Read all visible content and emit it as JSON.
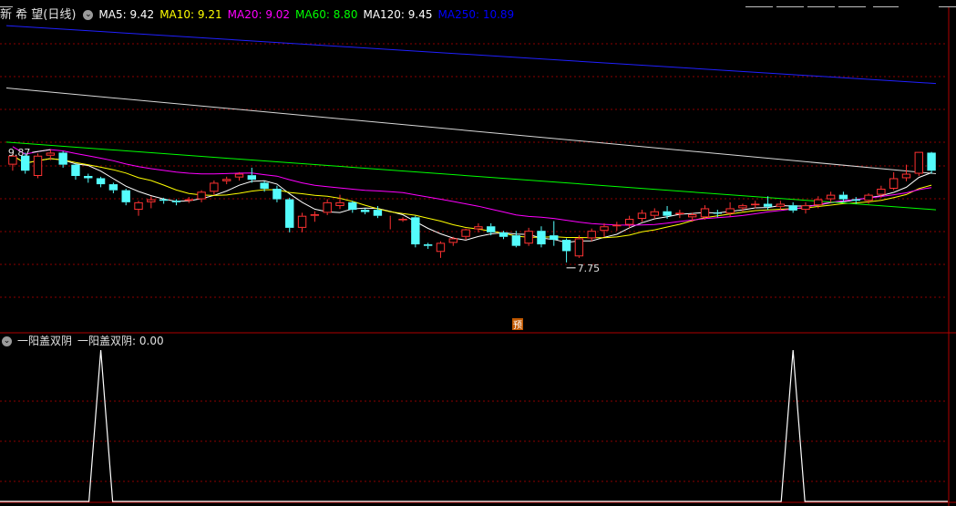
{
  "stock": {
    "name": "新 希 望",
    "period": "(日线)"
  },
  "ma_header": [
    {
      "label": "MA5: 9.42",
      "color": "#ffffff"
    },
    {
      "label": "MA10: 9.21",
      "color": "#ffff00"
    },
    {
      "label": "MA20: 9.02",
      "color": "#ff00ff"
    },
    {
      "label": "MA60: 8.80",
      "color": "#00ff00"
    },
    {
      "label": "MA120: 9.45",
      "color": "#ffffff"
    },
    {
      "label": "MA250: 10.89",
      "color": "#0000ff"
    }
  ],
  "indicator": {
    "name": "一阳盖双阴",
    "value_label": "一阳盖双阴: 0.00"
  },
  "annotations": {
    "high": "9.87",
    "low": "7.75",
    "marker": "预"
  },
  "colors": {
    "up": "#ff3232",
    "down": "#54fcfc",
    "grid": "#8b0000",
    "bg": "#000000"
  },
  "chart_data": {
    "type": "candlestick",
    "ylim": [
      7.5,
      11.6
    ],
    "candles": [
      [
        9.7,
        9.82,
        9.62,
        9.85
      ],
      [
        9.82,
        9.62,
        9.58,
        9.86
      ],
      [
        9.55,
        9.82,
        9.52,
        9.85
      ],
      [
        9.82,
        9.86,
        9.76,
        9.9
      ],
      [
        9.86,
        9.7,
        9.66,
        9.88
      ],
      [
        9.7,
        9.55,
        9.5,
        9.72
      ],
      [
        9.55,
        9.52,
        9.46,
        9.58
      ],
      [
        9.52,
        9.44,
        9.4,
        9.54
      ],
      [
        9.44,
        9.36,
        9.32,
        9.46
      ],
      [
        9.36,
        9.2,
        9.16,
        9.38
      ],
      [
        9.1,
        9.2,
        9.02,
        9.22
      ],
      [
        9.2,
        9.24,
        9.12,
        9.28
      ],
      [
        9.24,
        9.22,
        9.18,
        9.26
      ],
      [
        9.22,
        9.2,
        9.16,
        9.24
      ],
      [
        9.22,
        9.24,
        9.19,
        9.27
      ],
      [
        9.24,
        9.34,
        9.2,
        9.36
      ],
      [
        9.34,
        9.46,
        9.3,
        9.49
      ],
      [
        9.48,
        9.51,
        9.44,
        9.54
      ],
      [
        9.53,
        9.58,
        9.49,
        9.6
      ],
      [
        9.56,
        9.5,
        9.46,
        9.66
      ],
      [
        9.46,
        9.38,
        9.34,
        9.48
      ],
      [
        9.38,
        9.24,
        9.2,
        9.42
      ],
      [
        9.24,
        8.86,
        8.8,
        9.26
      ],
      [
        8.86,
        9.02,
        8.8,
        9.06
      ],
      [
        9.02,
        9.04,
        8.94,
        9.08
      ],
      [
        9.06,
        9.2,
        9.03,
        9.24
      ],
      [
        9.15,
        9.2,
        9.11,
        9.3
      ],
      [
        9.2,
        9.1,
        9.06,
        9.22
      ],
      [
        9.1,
        9.07,
        9.04,
        9.12
      ],
      [
        9.1,
        9.02,
        8.99,
        9.15
      ],
      [
        9.0,
        9.0,
        8.84,
        9.02
      ],
      [
        8.96,
        8.98,
        8.94,
        9.0
      ],
      [
        9.0,
        8.64,
        8.6,
        9.02
      ],
      [
        8.64,
        8.62,
        8.58,
        8.66
      ],
      [
        8.54,
        8.66,
        8.46,
        8.68
      ],
      [
        8.66,
        8.72,
        8.62,
        8.74
      ],
      [
        8.74,
        8.84,
        8.7,
        8.85
      ],
      [
        8.84,
        8.88,
        8.8,
        8.92
      ],
      [
        8.88,
        8.8,
        8.76,
        8.92
      ],
      [
        8.8,
        8.74,
        8.71,
        8.82
      ],
      [
        8.76,
        8.62,
        8.6,
        8.82
      ],
      [
        8.65,
        8.82,
        8.62,
        8.86
      ],
      [
        8.82,
        8.64,
        8.6,
        8.88
      ],
      [
        8.76,
        8.7,
        8.62,
        8.95
      ],
      [
        8.7,
        8.55,
        8.4,
        8.72
      ],
      [
        8.48,
        8.72,
        8.46,
        8.76
      ],
      [
        8.72,
        8.82,
        8.68,
        8.85
      ],
      [
        8.82,
        8.88,
        8.74,
        8.92
      ],
      [
        8.88,
        8.9,
        8.82,
        8.94
      ],
      [
        8.9,
        8.98,
        8.86,
        9.02
      ],
      [
        8.98,
        9.06,
        8.94,
        9.1
      ],
      [
        9.02,
        9.08,
        8.98,
        9.12
      ],
      [
        9.08,
        9.02,
        8.98,
        9.15
      ],
      [
        9.04,
        9.06,
        8.99,
        9.1
      ],
      [
        9.0,
        9.04,
        8.94,
        9.06
      ],
      [
        9.0,
        9.12,
        8.97,
        9.16
      ],
      [
        9.06,
        9.05,
        9.0,
        9.1
      ],
      [
        9.05,
        9.12,
        9.01,
        9.2
      ],
      [
        9.12,
        9.16,
        9.08,
        9.18
      ],
      [
        9.16,
        9.18,
        9.12,
        9.22
      ],
      [
        9.18,
        9.14,
        9.1,
        9.28
      ],
      [
        9.14,
        9.18,
        9.1,
        9.22
      ],
      [
        9.16,
        9.09,
        9.06,
        9.2
      ],
      [
        9.1,
        9.16,
        9.05,
        9.2
      ],
      [
        9.16,
        9.24,
        9.12,
        9.28
      ],
      [
        9.24,
        9.3,
        9.2,
        9.34
      ],
      [
        9.3,
        9.24,
        9.2,
        9.34
      ],
      [
        9.24,
        9.22,
        9.18,
        9.27
      ],
      [
        9.22,
        9.3,
        9.18,
        9.32
      ],
      [
        9.3,
        9.38,
        9.26,
        9.42
      ],
      [
        9.38,
        9.52,
        9.36,
        9.6
      ],
      [
        9.52,
        9.58,
        9.48,
        9.7
      ],
      [
        9.58,
        9.87,
        9.55,
        9.87
      ],
      [
        9.86,
        9.62,
        9.58,
        9.87
      ]
    ],
    "indicator_signal_indices": [
      7,
      62
    ],
    "indicator_values_at_signal": 1
  }
}
